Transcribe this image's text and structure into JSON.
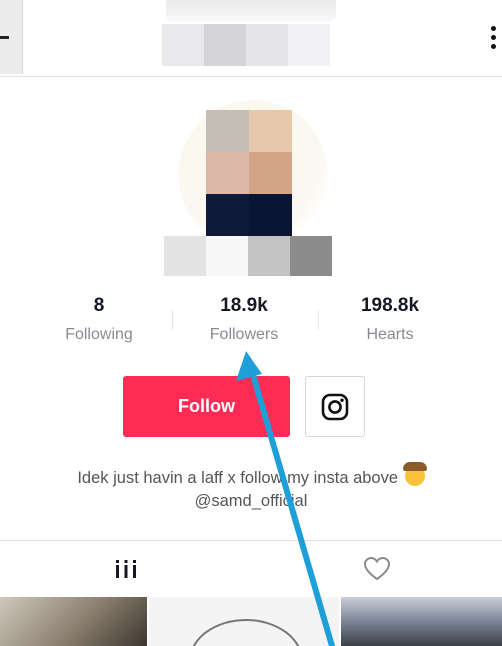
{
  "header": {
    "back_icon": "back-icon",
    "more_icon": "more-vertical-icon"
  },
  "profile": {
    "stats": [
      {
        "value": "8",
        "label": "Following"
      },
      {
        "value": "18.9k",
        "label": "Followers"
      },
      {
        "value": "198.8k",
        "label": "Hearts"
      }
    ],
    "follow_label": "Follow",
    "instagram_icon": "instagram-icon",
    "bio_line1": "Idek just havin a laff x follow my insta above",
    "bio_emoji": "cowboy-emoji",
    "bio_line2": "@samd_official"
  },
  "tabs": [
    {
      "icon": "grid-icon"
    },
    {
      "icon": "heart-icon"
    }
  ],
  "colors": {
    "follow_button": "#fe2c55",
    "annotation_arrow": "#1e9fd8",
    "secondary_text": "#8a8b91"
  }
}
